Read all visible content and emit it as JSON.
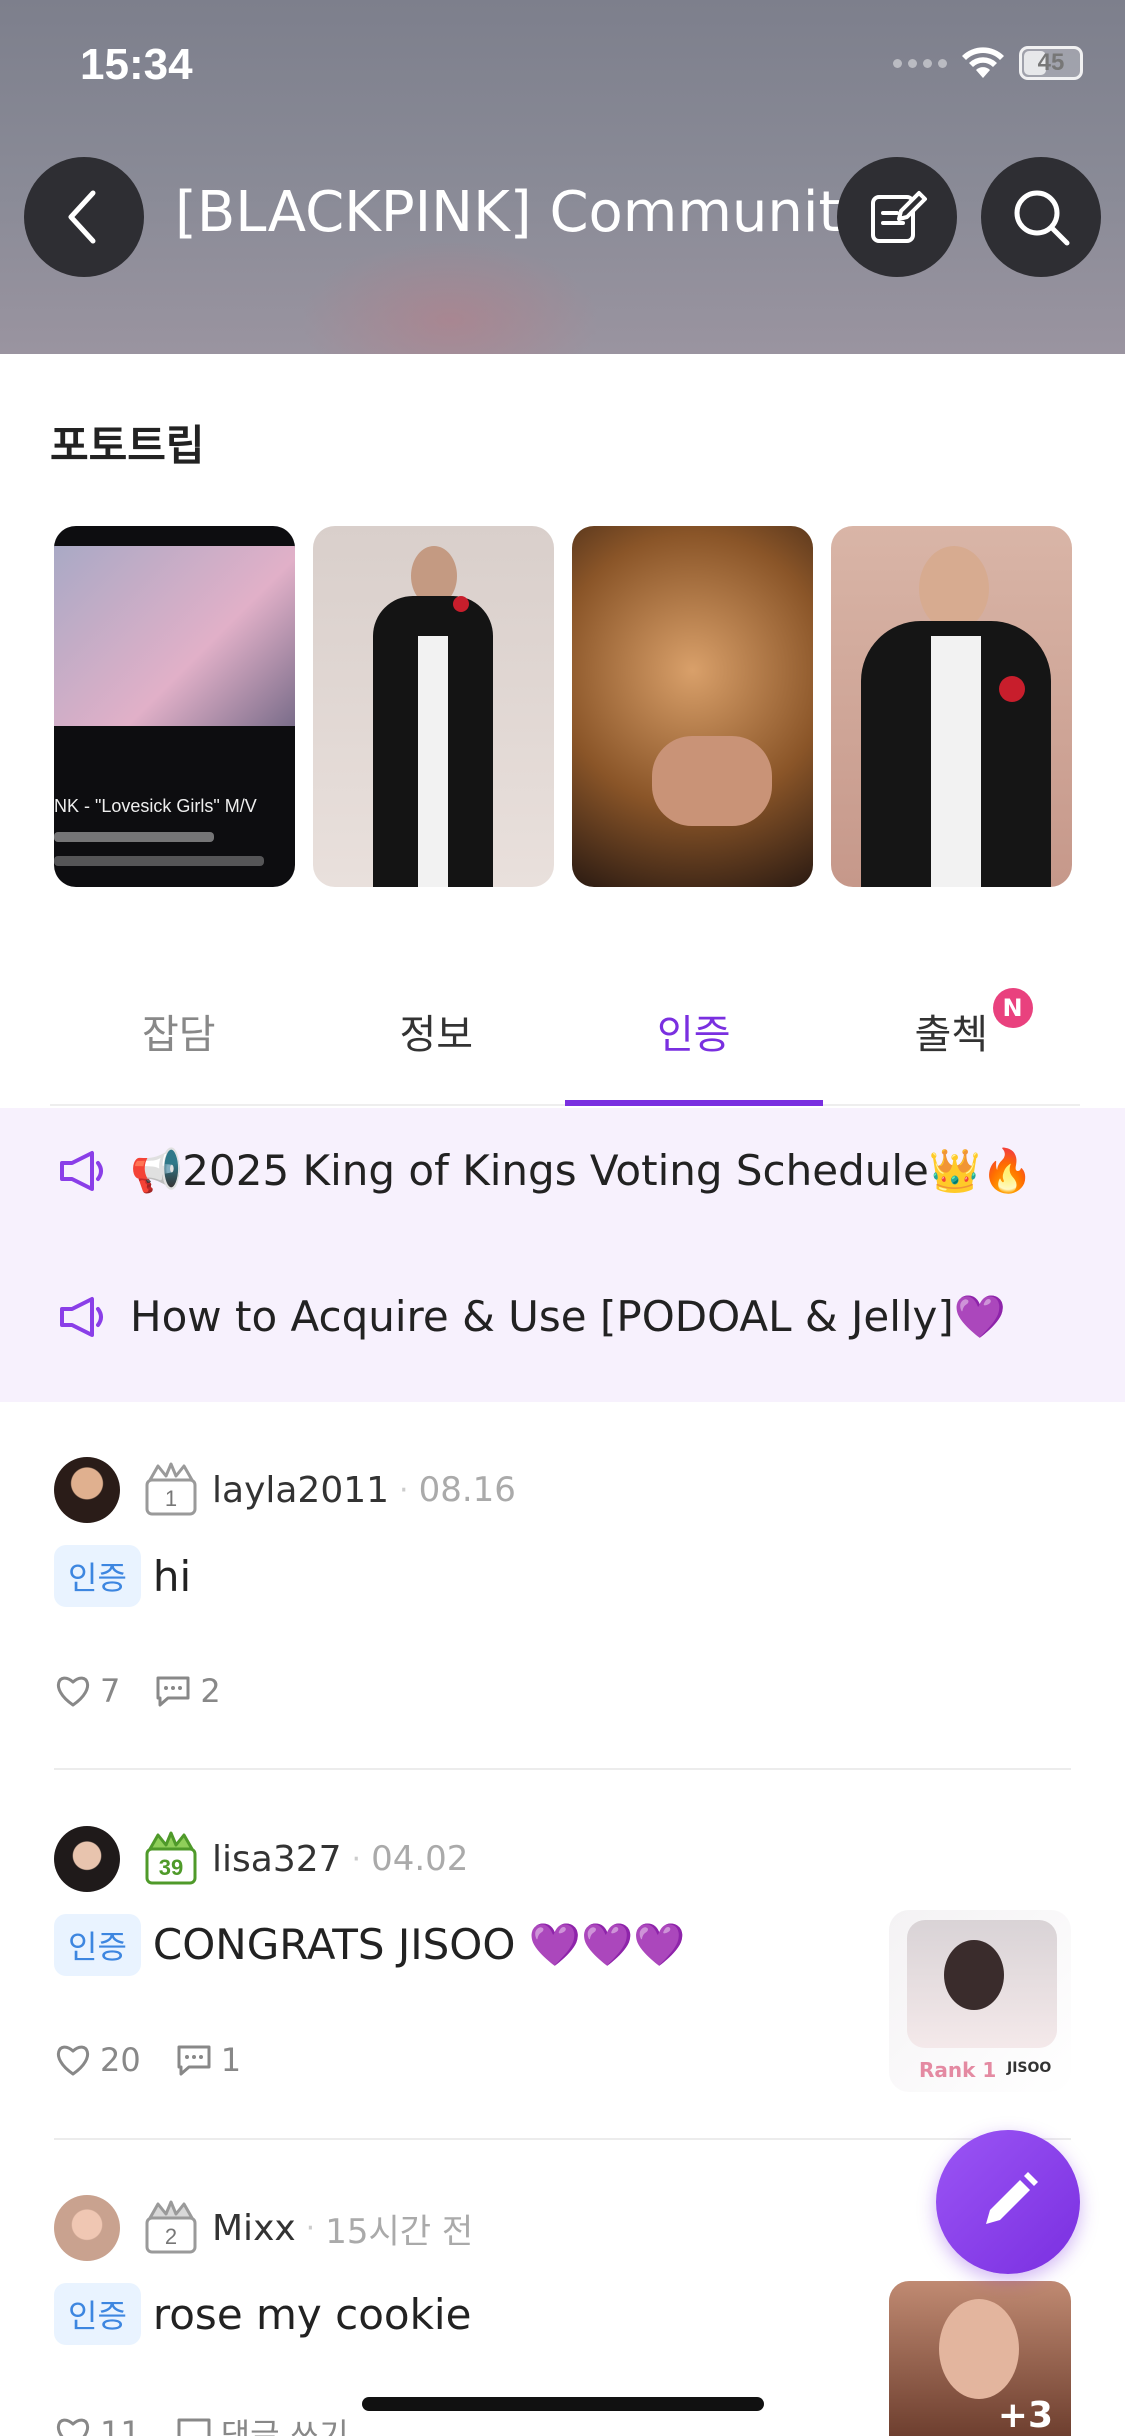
{
  "status_bar": {
    "time": "15:34",
    "battery": "45",
    "battery_level": 0.45
  },
  "header": {
    "title": "[BLACKPINK] Community"
  },
  "portrait_section": {
    "title": "포토트립",
    "items": [
      {
        "name": "portrait-video-still",
        "caption": "NK - \"Lovesick Girls\" M/V"
      },
      {
        "name": "portrait-red-carpet"
      },
      {
        "name": "portrait-closeup"
      },
      {
        "name": "portrait-tuxedo"
      }
    ]
  },
  "tabs": [
    {
      "label": "잡담",
      "state": "inactive"
    },
    {
      "label": "정보",
      "state": "normal"
    },
    {
      "label": "인증",
      "state": "active"
    },
    {
      "label": "출첵",
      "state": "normal",
      "badge": "N"
    }
  ],
  "notices": [
    {
      "text": "📢2025 King of Kings Voting Schedule👑🔥"
    },
    {
      "text": "How to Acquire & Use [PODOAL & Jelly]💜"
    }
  ],
  "posts": [
    {
      "username": "layla2011",
      "date": "08.16",
      "level": "1",
      "tag": "인증",
      "text": "hi",
      "likes": "7",
      "comments": "2"
    },
    {
      "username": "lisa327",
      "date": "04.02",
      "level": "39",
      "tag": "인증",
      "text": "CONGRATS JISOO 💜💜💜",
      "likes": "20",
      "comments": "1",
      "thumb_label": "Rank 1",
      "thumb_name": "JISOO"
    },
    {
      "username": "Mixx",
      "date": "15시간 전",
      "level": "2",
      "tag": "인증",
      "text": "rose my cookie",
      "likes": "11",
      "comments": "댓글 쓰기",
      "thumb_more": "+3"
    }
  ],
  "colors": {
    "accent": "#7a2fe0",
    "badge": "#e9417e",
    "tag_bg": "#e9f3ff",
    "tag_text": "#3d86e0",
    "notice_bg": "#f7f1fd"
  }
}
